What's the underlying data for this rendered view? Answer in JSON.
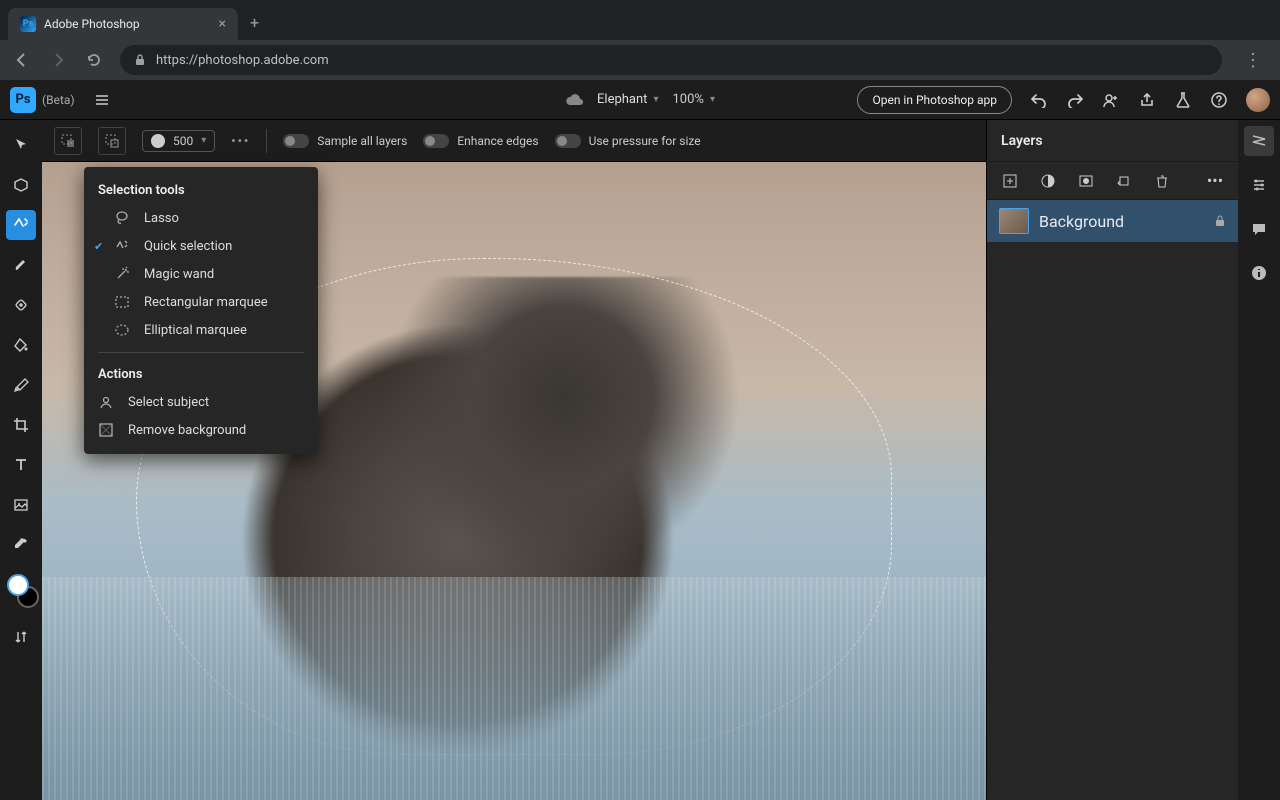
{
  "browser": {
    "tab_title": "Adobe Photoshop",
    "url": "https://photoshop.adobe.com"
  },
  "app": {
    "logo_text": "Ps",
    "beta_label": "(Beta)",
    "doc_name": "Elephant",
    "zoom": "100%",
    "open_button": "Open in Photoshop app"
  },
  "options": {
    "brush_size": "500",
    "sample_all": "Sample all layers",
    "enhance_edges": "Enhance edges",
    "use_pressure": "Use pressure for size"
  },
  "flyout": {
    "heading_tools": "Selection tools",
    "lasso": "Lasso",
    "quick_selection": "Quick selection",
    "magic_wand": "Magic wand",
    "rect_marquee": "Rectangular marquee",
    "ellip_marquee": "Elliptical marquee",
    "heading_actions": "Actions",
    "select_subject": "Select subject",
    "remove_bg": "Remove background"
  },
  "layers": {
    "panel_title": "Layers",
    "background": "Background"
  }
}
